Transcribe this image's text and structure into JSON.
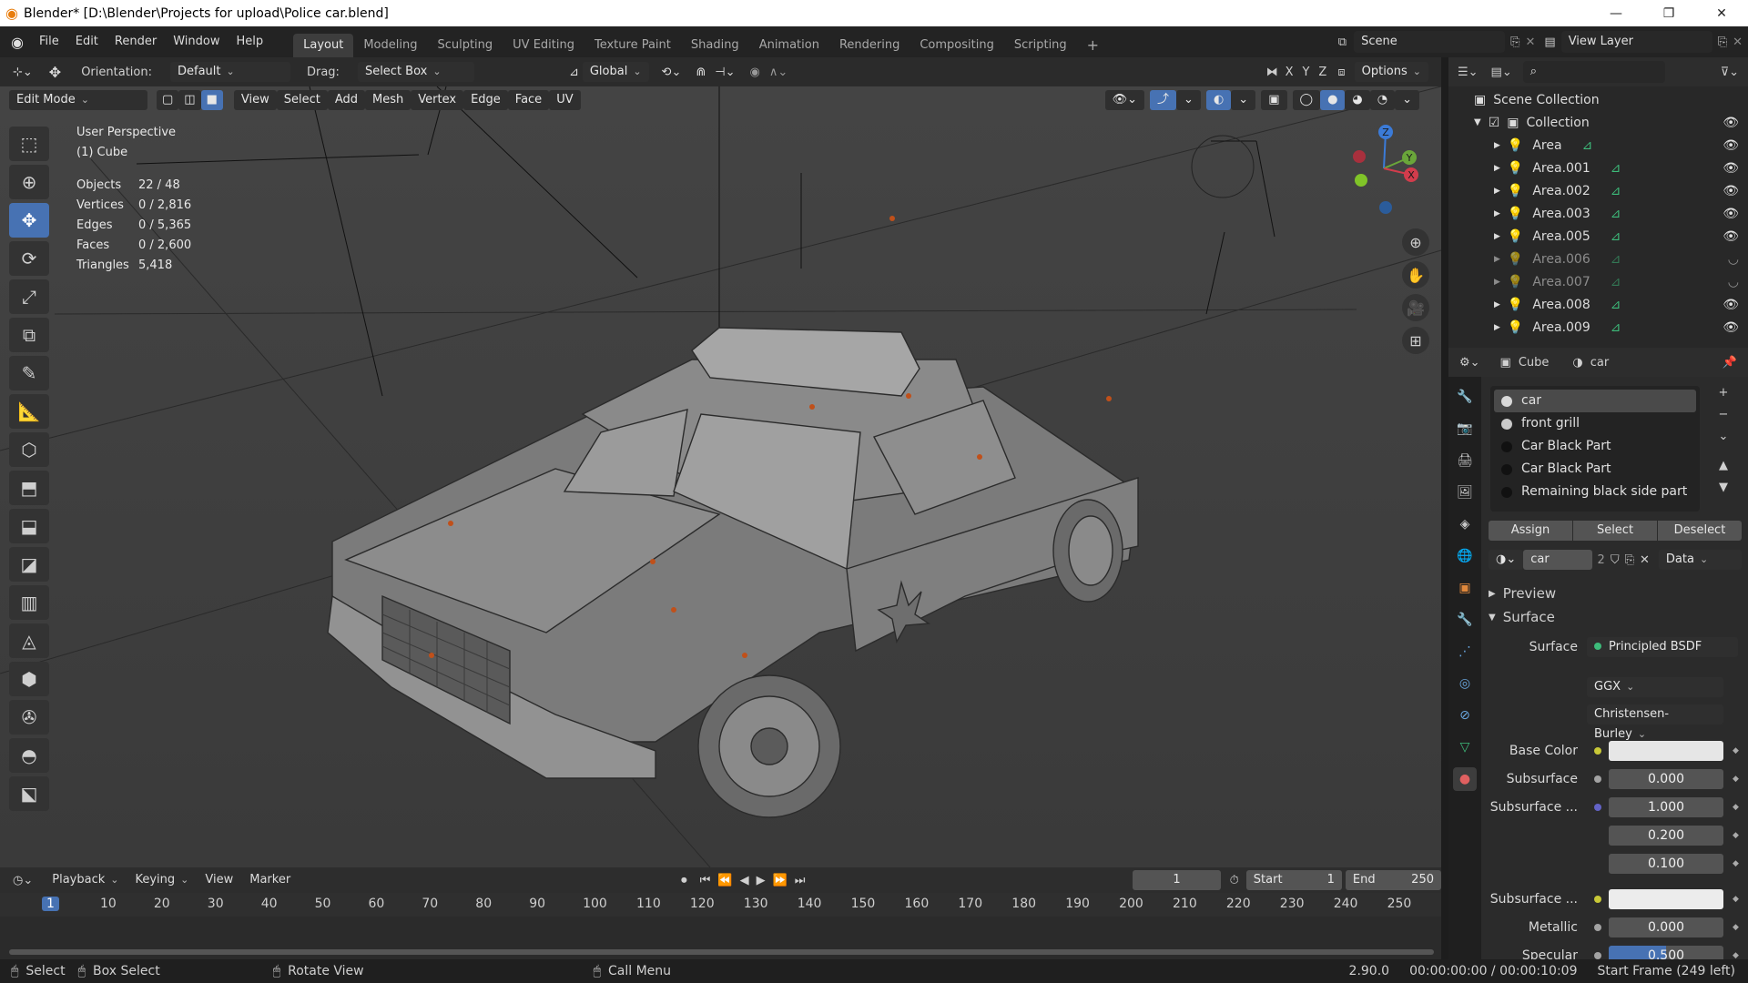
{
  "window": {
    "title": "Blender* [D:\\Blender\\Projects for upload\\Police car.blend]",
    "controls": [
      "—",
      "❐",
      "✕"
    ]
  },
  "menu": [
    "File",
    "Edit",
    "Render",
    "Window",
    "Help"
  ],
  "workspaces": [
    "Layout",
    "Modeling",
    "Sculpting",
    "UV Editing",
    "Texture Paint",
    "Shading",
    "Animation",
    "Rendering",
    "Compositing",
    "Scripting"
  ],
  "active_workspace": "Layout",
  "scene": "Scene",
  "view_layer": "View Layer",
  "header": {
    "orientation_label": "Orientation:",
    "orientation_value": "Default",
    "drag_label": "Drag:",
    "drag_value": "Select Box",
    "transform_orientation": "Global",
    "axes": [
      "X",
      "Y",
      "Z"
    ],
    "options": "Options"
  },
  "viewport_menu": {
    "mode": "Edit Mode",
    "items": [
      "View",
      "Select",
      "Add",
      "Mesh",
      "Vertex",
      "Edge",
      "Face",
      "UV"
    ]
  },
  "viewport_info": {
    "perspective": "User Perspective",
    "object": "(1) Cube",
    "stats": [
      {
        "label": "Objects",
        "value": "22 / 48"
      },
      {
        "label": "Vertices",
        "value": "0 / 2,816"
      },
      {
        "label": "Edges",
        "value": "0 / 5,365"
      },
      {
        "label": "Faces",
        "value": "0 / 2,600"
      },
      {
        "label": "Triangles",
        "value": "5,418"
      }
    ]
  },
  "gizmo_axes": [
    "Z",
    "Y",
    "X"
  ],
  "outliner": {
    "root": "Scene Collection",
    "collection": "Collection",
    "items": [
      {
        "name": "Area",
        "visible": true
      },
      {
        "name": "Area.001",
        "visible": true
      },
      {
        "name": "Area.002",
        "visible": true
      },
      {
        "name": "Area.003",
        "visible": true
      },
      {
        "name": "Area.005",
        "visible": true
      },
      {
        "name": "Area.006",
        "visible": false
      },
      {
        "name": "Area.007",
        "visible": false
      },
      {
        "name": "Area.008",
        "visible": true
      },
      {
        "name": "Area.009",
        "visible": true
      }
    ]
  },
  "properties": {
    "object": "Cube",
    "material": "car",
    "slots": [
      {
        "name": "car",
        "color": "#d8d8d8"
      },
      {
        "name": "front grill",
        "color": "#c9c9c9"
      },
      {
        "name": "Car Black Part",
        "color": "#111111"
      },
      {
        "name": "Car Black Part",
        "color": "#111111"
      },
      {
        "name": "Remaining black side part",
        "color": "#111111"
      }
    ],
    "buttons": [
      "Assign",
      "Select",
      "Deselect"
    ],
    "material_name": "car",
    "users": "2",
    "link": "Data",
    "panels": [
      "Preview",
      "Surface"
    ],
    "surface": {
      "label": "Surface",
      "shader": "Principled BSDF",
      "distribution": "GGX",
      "subsurface_method": "Christensen-Burley",
      "rows": [
        {
          "label": "Base Color",
          "value": "",
          "dot": "#c8c837",
          "swatch": "#e6e6e6"
        },
        {
          "label": "Subsurface",
          "value": "0.000",
          "dot": "#a3a3a3"
        },
        {
          "label": "Subsurface ...",
          "value": "1.000",
          "dot": "#6363c7"
        },
        {
          "label": "",
          "value": "0.200"
        },
        {
          "label": "",
          "value": "0.100"
        },
        {
          "label": "Subsurface ...",
          "value": "",
          "dot": "#c8c837",
          "swatch": "#ececec"
        },
        {
          "label": "Metallic",
          "value": "0.000",
          "dot": "#a3a3a3"
        },
        {
          "label": "Specular",
          "value": "0.500",
          "dot": "#a3a3a3",
          "fill": 0.5
        }
      ]
    }
  },
  "timeline": {
    "menus": [
      "Playback",
      "Keying",
      "View",
      "Marker"
    ],
    "current_frame": "1",
    "start_label": "Start",
    "start": "1",
    "end_label": "End",
    "end": "250",
    "ticks": [
      "1",
      "10",
      "20",
      "30",
      "40",
      "50",
      "60",
      "70",
      "80",
      "90",
      "100",
      "110",
      "120",
      "130",
      "140",
      "150",
      "160",
      "170",
      "180",
      "190",
      "200",
      "210",
      "220",
      "230",
      "240",
      "250"
    ]
  },
  "status": {
    "select": "Select",
    "box_select": "Box Select",
    "rotate": "Rotate View",
    "call_menu": "Call Menu",
    "version": "2.90.0",
    "time": "00:00:00:00 / 00:00:10:09",
    "frame_info": "Start Frame (249 left)"
  }
}
